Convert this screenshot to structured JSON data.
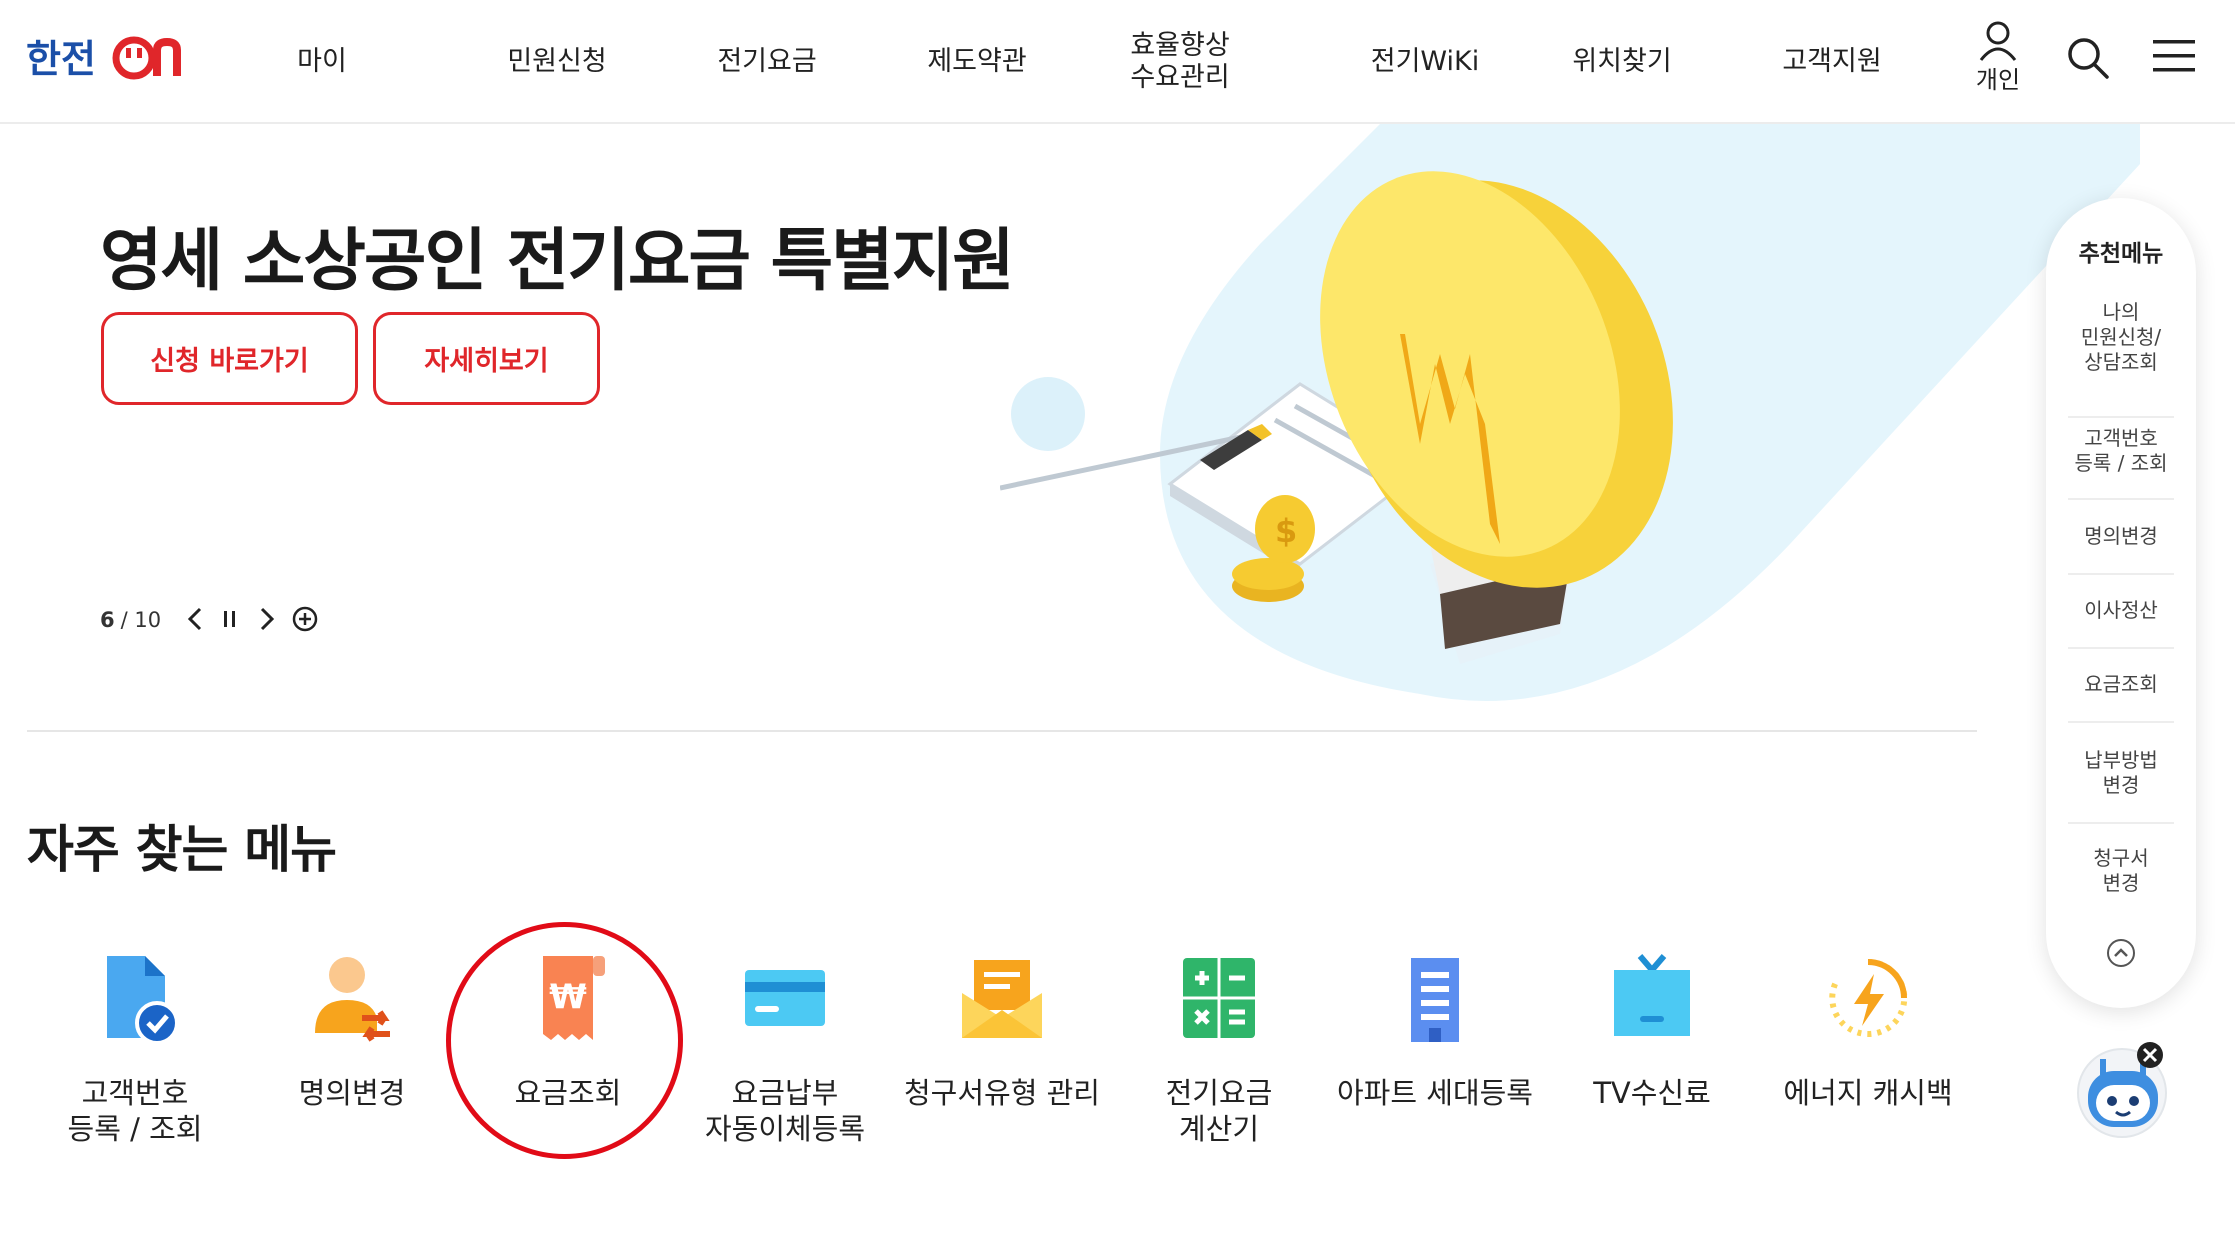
{
  "header": {
    "logo_text": "한전ON",
    "nav": [
      "마이",
      "민원신청",
      "전기요금",
      "제도약관",
      "효율향상\n수요관리",
      "전기WiKi",
      "위치찾기",
      "고객지원"
    ],
    "user_label": "개인"
  },
  "hero": {
    "title": "영세 소상공인 전기요금 특별지원",
    "apply_button": "신청 바로가기",
    "detail_button": "자세히보기",
    "pager_current": "6",
    "pager_total": "/ 10"
  },
  "frequent": {
    "title": "자주 찾는 메뉴",
    "items": [
      "고객번호\n등록 / 조회",
      "명의변경",
      "요금조회",
      "요금납부\n자동이체등록",
      "청구서유형 관리",
      "전기요금\n계산기",
      "아파트 세대등록",
      "TV수신료",
      "에너지 캐시백"
    ]
  },
  "sidebar": {
    "title": "추천메뉴",
    "items": [
      "나의\n민원신청/\n상담조회",
      "고객번호\n등록 / 조회",
      "명의변경",
      "이사정산",
      "요금조회",
      "납부방법\n변경",
      "청구서\n변경"
    ]
  },
  "colors": {
    "brand_blue": "#1b4fa8",
    "brand_red": "#e0262a",
    "highlight": "#e10b17"
  }
}
